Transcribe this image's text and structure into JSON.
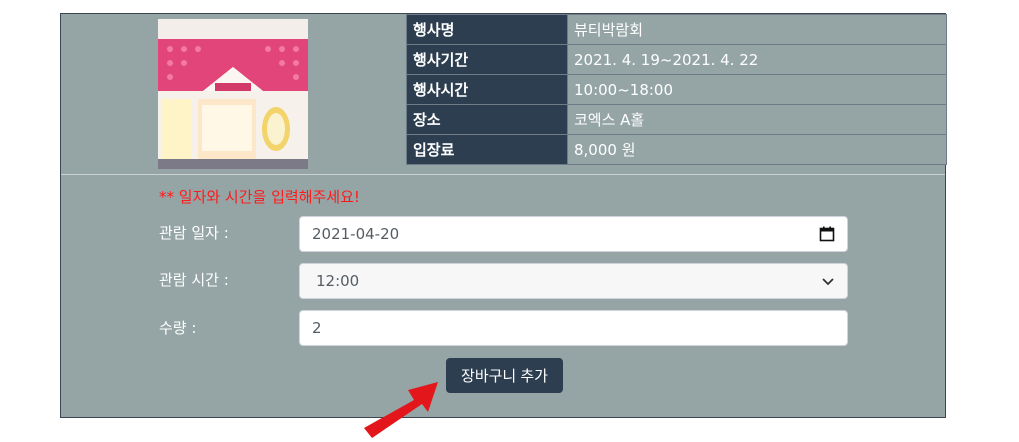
{
  "event_table": [
    {
      "key": "행사명",
      "value": "뷰티박람회"
    },
    {
      "key": "행사기간",
      "value": "2021. 4. 19~2021. 4. 22"
    },
    {
      "key": "행사시간",
      "value": "10:00~18:00"
    },
    {
      "key": "장소",
      "value": "코엑스 A홀"
    },
    {
      "key": "입장료",
      "value": "8,000 원"
    }
  ],
  "form": {
    "warning": "** 일자와 시간을 입력해주세요!",
    "date_label": "관람 일자 :",
    "date_value": "2021-04-20",
    "time_label": "관람 시간 :",
    "time_value": "12:00",
    "qty_label": "수량 :",
    "qty_value": "2",
    "submit_label": "장바구니 추가"
  },
  "colors": {
    "panel_bg": "#95a5a6",
    "header_cell": "#2c3e50",
    "button": "#2c3e50",
    "warning_text": "#ff1a1a",
    "arrow": "#e3171b"
  },
  "icons": {
    "date_picker": "calendar-icon",
    "select": "chevron-down-icon",
    "annotation": "red-arrow-icon"
  }
}
